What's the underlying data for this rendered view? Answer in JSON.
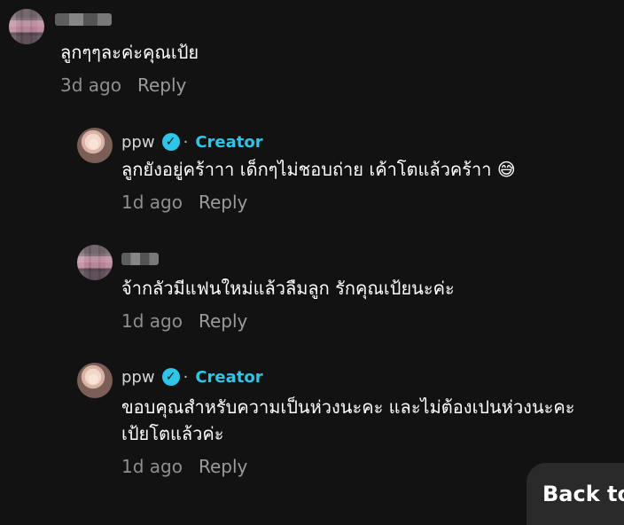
{
  "comments": [
    {
      "username_visible": false,
      "text": "ลูกๆๆละค่ะคุณเป้ย",
      "time": "3d ago",
      "reply_label": "Reply"
    },
    {
      "username": "ppw",
      "creator_label": "Creator",
      "text": "ลูกยังอยู่คร้าาา เด็กๆไม่ชอบถ่าย เค้าโตแล้วคร้าา 😅",
      "time": "1d ago",
      "reply_label": "Reply"
    },
    {
      "username_visible": false,
      "text": "จ้ากลัวมีแฟนใหม่แล้วลืมลูก รักคุณเป้ยนะค่ะ",
      "time": "1d ago",
      "reply_label": "Reply"
    },
    {
      "username": "ppw",
      "creator_label": "Creator",
      "text_line1": "ขอบคุณสำหรับความเป็นห่วงนะคะ และไม่ต้องเปนห่วงนะคะ",
      "text_line2": "เป้ยโตแล้วค่ะ",
      "time": "1d ago",
      "reply_label": "Reply"
    }
  ],
  "back_button": {
    "label": "Back to"
  },
  "colors": {
    "background": "#121212",
    "text": "#ffffff",
    "muted": "#8f8f8f",
    "creator_accent": "#2ec5e6"
  },
  "icons": {
    "verified": "verified-check-icon"
  }
}
